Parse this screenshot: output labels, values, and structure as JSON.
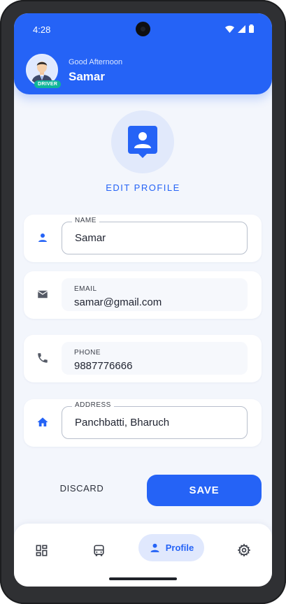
{
  "status_bar": {
    "time": "4:28"
  },
  "header": {
    "greeting": "Good Afternoon",
    "username": "Samar",
    "badge": "DRIVER"
  },
  "edit_profile": {
    "label": "EDIT PROFILE"
  },
  "fields": {
    "name": {
      "label": "NAME",
      "value": "Samar"
    },
    "email": {
      "label": "EMAIL",
      "value": "samar@gmail.com"
    },
    "phone": {
      "label": "PHONE",
      "value": "9887776666"
    },
    "address": {
      "label": "ADDRESS",
      "value": "Panchbatti, Bharuch"
    }
  },
  "actions": {
    "discard": "DISCARD",
    "save": "SAVE"
  },
  "bottom_nav": {
    "items": [
      {
        "icon": "dashboard-icon"
      },
      {
        "icon": "bus-icon"
      },
      {
        "icon": "person-icon",
        "label": "Profile",
        "active": true
      },
      {
        "icon": "gear-icon"
      }
    ]
  },
  "colors": {
    "primary": "#2563f6",
    "background": "#f3f6fc",
    "badge": "#0fb59a",
    "card": "#ffffff"
  }
}
